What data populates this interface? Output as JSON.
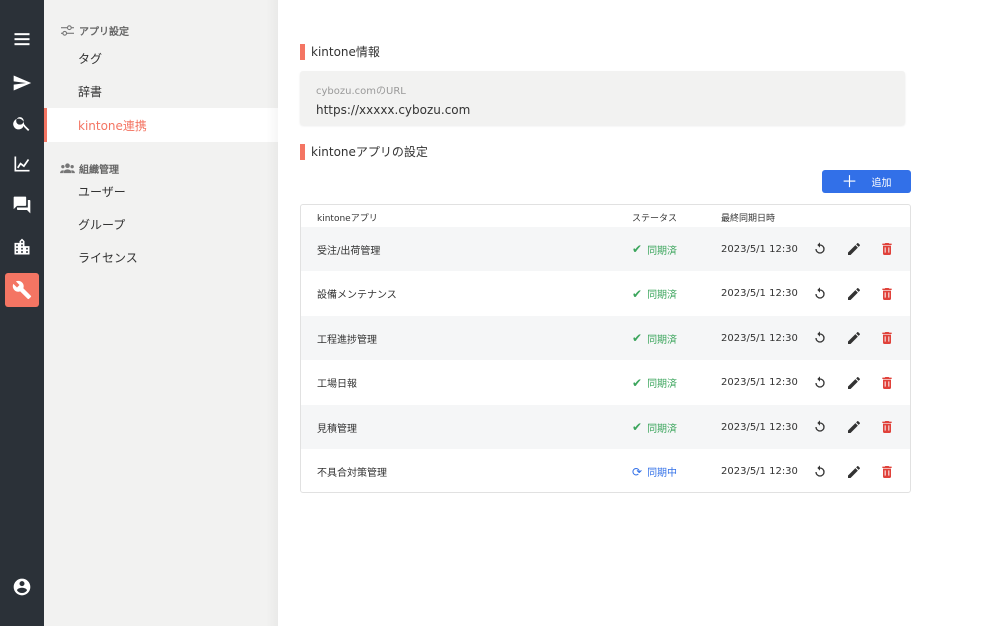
{
  "rail": {
    "items": [
      {
        "name": "menu-icon"
      },
      {
        "name": "send-icon"
      },
      {
        "name": "search-icon"
      },
      {
        "name": "chart-icon"
      },
      {
        "name": "chat-icon"
      },
      {
        "name": "building-icon"
      },
      {
        "name": "wrench-icon",
        "active": true
      },
      {
        "name": "account-icon"
      }
    ],
    "accent": "#f47563",
    "background": "#2b3138"
  },
  "sidebar": {
    "section1": "アプリ設定",
    "section2": "組織管理",
    "items": [
      {
        "label": "タグ"
      },
      {
        "label": "辞書"
      },
      {
        "label": "kintone連携",
        "active": true
      },
      {
        "label": "ユーザー"
      },
      {
        "label": "グループ"
      },
      {
        "label": "ライセンス"
      }
    ]
  },
  "main": {
    "info_title": "kintone情報",
    "url_label": "cybozu.comのURL",
    "url_value": "https://xxxxx.cybozu.com",
    "apps_title": "kintoneアプリの設定",
    "add_label": "追加",
    "add_color": "#3270e8"
  },
  "table": {
    "headers": {
      "app": "kintoneアプリ",
      "status": "ステータス",
      "last_sync": "最終同期日時"
    },
    "rows": [
      {
        "app": "受注/出荷管理",
        "status": "同期済",
        "state": "done",
        "last_sync": "2023/5/1 12:30"
      },
      {
        "app": "設備メンテナンス",
        "status": "同期済",
        "state": "done",
        "last_sync": "2023/5/1 12:30"
      },
      {
        "app": "工程進捗管理",
        "status": "同期済",
        "state": "done",
        "last_sync": "2023/5/1 12:30"
      },
      {
        "app": "工場日報",
        "status": "同期済",
        "state": "done",
        "last_sync": "2023/5/1 12:30"
      },
      {
        "app": "見積管理",
        "status": "同期済",
        "state": "done",
        "last_sync": "2023/5/1 12:30"
      },
      {
        "app": "不具合対策管理",
        "status": "同期中",
        "state": "sync",
        "last_sync": "2023/5/1 12:30"
      }
    ],
    "status_colors": {
      "done": "#3ba55c",
      "sync": "#3270e8"
    },
    "delete_color": "#e0413a"
  }
}
